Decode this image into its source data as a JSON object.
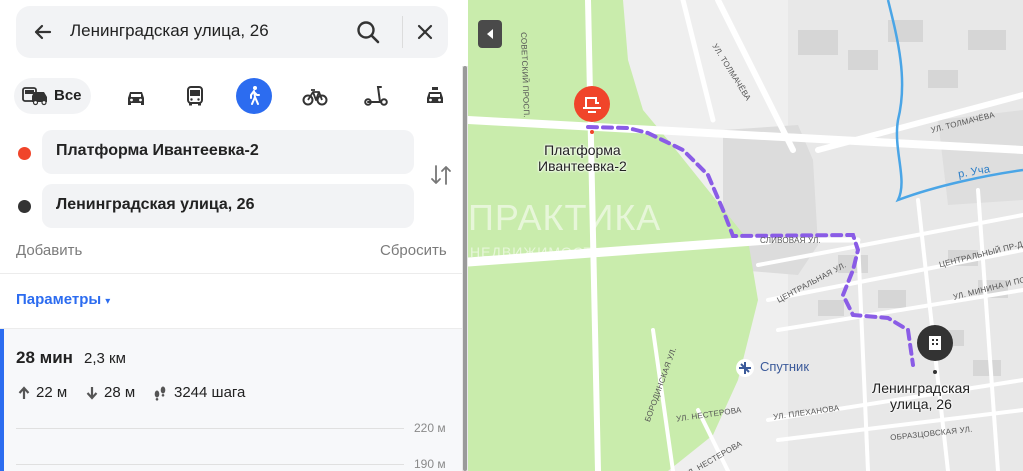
{
  "search": {
    "query": "Ленинградская улица, 26"
  },
  "modes": {
    "all_label": "Все"
  },
  "route": {
    "from": "Платформа Ивантеевка-2",
    "to": "Ленинградская улица, 26",
    "add_label": "Добавить",
    "reset_label": "Сбросить",
    "params_label": "Параметры",
    "params_caret": "▾"
  },
  "result": {
    "time": "28 мин",
    "distance": "2,3 км",
    "ascent": "22 м",
    "descent": "28 м",
    "steps": "3244 шага",
    "elevation_ticks": [
      "220 м",
      "190 м"
    ]
  },
  "map": {
    "start_label_line1": "Платформа",
    "start_label_line2": "Ивантеевка-2",
    "end_label_line1": "Ленинградская",
    "end_label_line2": "улица, 26",
    "poi_sputnik": "Спутник",
    "watermark_main": "ПРАКТИКА",
    "watermark_sub": "НЕДВИЖИМОСТЬ",
    "streets": {
      "sovetsky": "СОВЕТСКИЙ ПРОСП.",
      "tolmacheva_v": "УЛ. ТОЛМАЧЁВА",
      "tolmacheva_h": "УЛ. ТОЛМАЧЁВА",
      "river": "р. Уча",
      "slivovaya": "СЛИВОВАЯ УЛ.",
      "centralnaya": "ЦЕНТРАЛЬНАЯ УЛ.",
      "centralny_pr": "ЦЕНТРАЛЬНЫЙ ПР-Д",
      "minina": "УЛ. МИНИНА И ПОЖ",
      "borodinskaya": "БОРОДИНСКАЯ УЛ.",
      "nesterova1": "УЛ. НЕСТЕРОВА",
      "nesterova2": "УЛ. НЕСТЕРОВА",
      "plekhanova": "УЛ. ПЛЕХАНОВА",
      "obraztsovskaya": "ОБРАЗЦОВСКАЯ УЛ."
    }
  },
  "colors": {
    "accent": "#2c6cf0",
    "route": "#8a5ce6",
    "start_marker": "#f0452a",
    "end_marker": "#333333",
    "park": "#c9ecac"
  }
}
